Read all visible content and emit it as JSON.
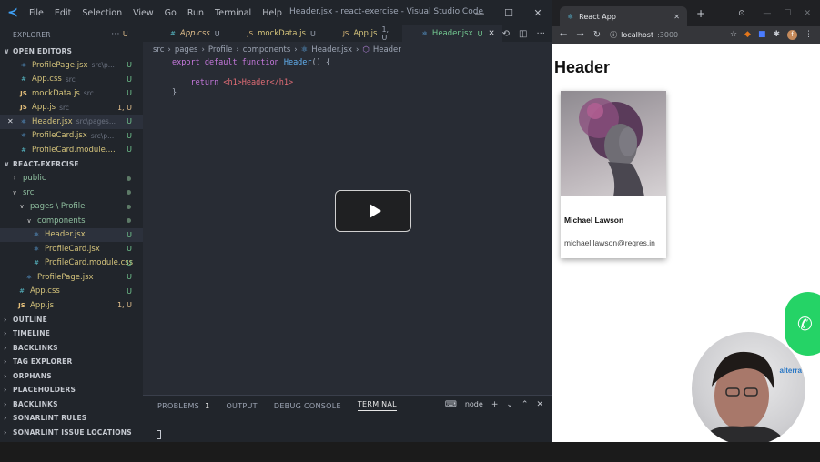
{
  "vscode": {
    "menu": [
      "File",
      "Edit",
      "Selection",
      "View",
      "Go",
      "Run",
      "Terminal",
      "Help"
    ],
    "window_title": "Header.jsx - react-exercise - Visual Studio Code",
    "explorer_label": "EXPLORER",
    "open_editors_label": "OPEN EDITORS",
    "open_editors": [
      {
        "name": "ProfilePage.jsx",
        "path": "src\\p...",
        "badge": "U",
        "icon": "react-icon"
      },
      {
        "name": "App.css",
        "path": "src",
        "badge": "U",
        "icon": "css-icon"
      },
      {
        "name": "mockData.js",
        "path": "src",
        "badge": "U",
        "icon": "js-icon"
      },
      {
        "name": "App.js",
        "path": "src",
        "badge": "1, U",
        "icon": "js-icon"
      },
      {
        "name": "Header.jsx",
        "path": "src\\pages...",
        "badge": "U",
        "icon": "react-icon",
        "close": "✕"
      },
      {
        "name": "ProfileCard.jsx",
        "path": "src\\p...",
        "badge": "U",
        "icon": "react-icon"
      },
      {
        "name": "ProfileCard.module....",
        "path": "",
        "badge": "U",
        "icon": "css-icon"
      }
    ],
    "project_label": "REACT-EXERCISE",
    "tree": [
      {
        "name": "public",
        "indent": 1,
        "kind": "folder-closed"
      },
      {
        "name": "src",
        "indent": 1,
        "kind": "folder-open"
      },
      {
        "name": "pages \\ Profile",
        "indent": 2,
        "kind": "folder-open"
      },
      {
        "name": "components",
        "indent": 3,
        "kind": "folder-open"
      },
      {
        "name": "Header.jsx",
        "indent": 4,
        "kind": "react",
        "badge": "U"
      },
      {
        "name": "ProfileCard.jsx",
        "indent": 4,
        "kind": "react",
        "badge": "U"
      },
      {
        "name": "ProfileCard.module.css",
        "indent": 4,
        "kind": "css",
        "badge": "U"
      },
      {
        "name": "ProfilePage.jsx",
        "indent": 3,
        "kind": "react",
        "badge": "U"
      },
      {
        "name": "App.css",
        "indent": 2,
        "kind": "css",
        "badge": "U"
      },
      {
        "name": "App.js",
        "indent": 2,
        "kind": "js",
        "badge": "1, U"
      }
    ],
    "bottom_sections": [
      "OUTLINE",
      "TIMELINE",
      "BACKLINKS",
      "TAG EXPLORER",
      "ORPHANS",
      "PLACEHOLDERS",
      "BACKLINKS",
      "SONARLINT RULES",
      "SONARLINT ISSUE LOCATIONS"
    ],
    "tabs": [
      {
        "name": "App.css",
        "mod": "U",
        "icon": "#"
      },
      {
        "name": "mockData.js",
        "mod": "U",
        "icon": "JS"
      },
      {
        "name": "App.js",
        "mod": "1, U",
        "icon": "JS"
      },
      {
        "name": "Header.jsx",
        "mod": "U",
        "icon": "⚛",
        "active": true
      }
    ],
    "breadcrumb": [
      "src",
      "pages",
      "Profile",
      "components",
      "Header.jsx",
      "Header"
    ],
    "code": {
      "line1_kw": "export default function",
      "line1_fn": "Header",
      "line1_tail": "() {",
      "line3_kw": "return",
      "line3_body": "<h1>Header</h1>",
      "line4": "}"
    },
    "panel": {
      "tabs": [
        "PROBLEMS",
        "OUTPUT",
        "DEBUG CONSOLE",
        "TERMINAL"
      ],
      "problems_count": "1",
      "terminal_name": "node"
    }
  },
  "browser": {
    "tab_title": "React App",
    "url_prefix": "localhost",
    "url_port": ":3000",
    "page_heading": "Header",
    "card": {
      "name": "Michael Lawson",
      "email": "michael.lawson@reqres.in"
    },
    "webcam_logo": "alterra"
  }
}
